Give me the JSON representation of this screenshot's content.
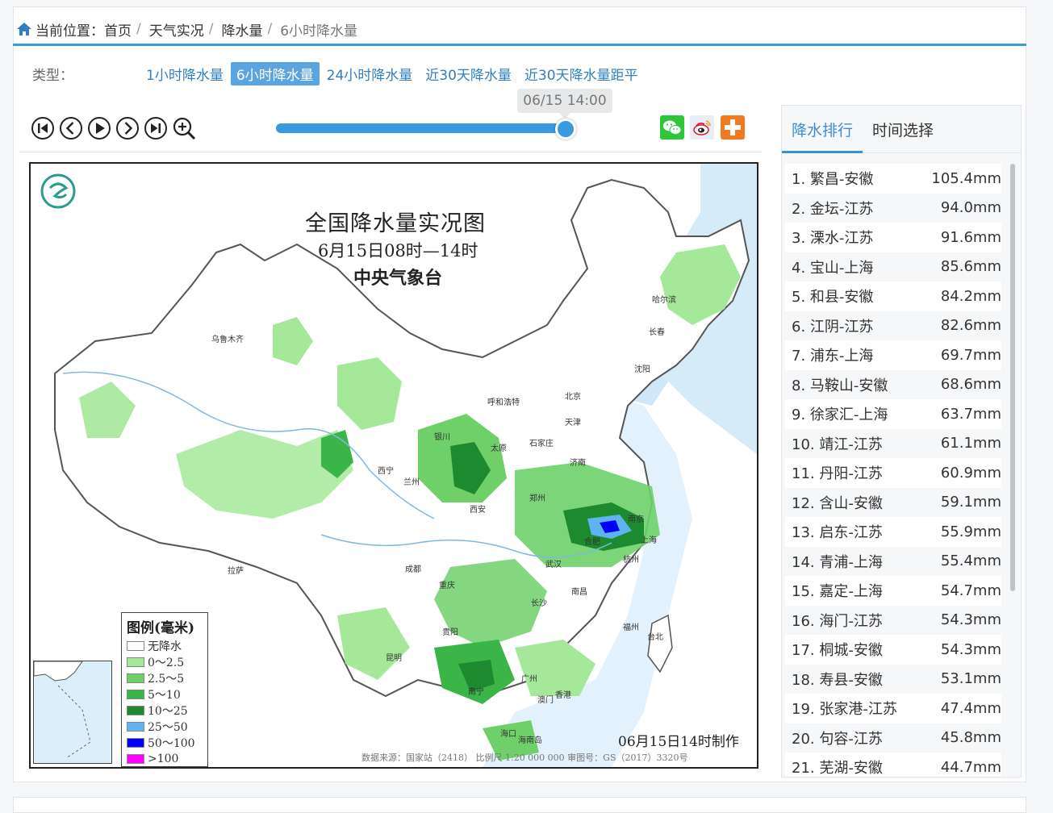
{
  "breadcrumb": {
    "prefix": "当前位置：",
    "items": [
      "首页",
      "天气实况",
      "降水量",
      "6小时降水量"
    ]
  },
  "type_bar": {
    "label": "类型：",
    "options": [
      "1小时降水量",
      "6小时降水量",
      "24小时降水量",
      "近30天降水量",
      "近30天降水量距平"
    ],
    "active_index": 1
  },
  "player": {
    "time_tip": "06/15 14:00",
    "progress": 1.0,
    "controls": [
      "first-icon",
      "prev-icon",
      "play-icon",
      "next-icon",
      "last-icon",
      "zoom-in-icon"
    ],
    "share": [
      "wechat-icon",
      "weibo-icon",
      "plus-icon"
    ]
  },
  "map": {
    "title": "全国降水量实况图",
    "subtitle": "6月15日08时—14时",
    "org": "中央气象台",
    "made": "06月15日14时制作",
    "source": "数据来源：国家站（2418）  比例尺 1:20 000 000    审图号：GS（2017）3320号",
    "legend_title": "图例(毫米)",
    "legend": [
      {
        "label": "无降水",
        "color": "#ffffff"
      },
      {
        "label": "0～2.5",
        "color": "#a6e89a"
      },
      {
        "label": "2.5～5",
        "color": "#6fd06a"
      },
      {
        "label": "5～10",
        "color": "#3cb548"
      },
      {
        "label": "10～25",
        "color": "#1e8a30"
      },
      {
        "label": "25～50",
        "color": "#5fb3f0"
      },
      {
        "label": "50～100",
        "color": "#0000ff"
      },
      {
        "label": ">100",
        "color": "#ff00ff"
      }
    ],
    "cities": [
      "乌鲁木齐",
      "哈尔滨",
      "长春",
      "沈阳",
      "呼和浩特",
      "北京",
      "天津",
      "银川",
      "太原",
      "石家庄",
      "西宁",
      "兰州",
      "济南",
      "郑州",
      "西安",
      "合肥",
      "南京",
      "上海",
      "杭州",
      "成都",
      "武汉",
      "重庆",
      "南昌",
      "拉萨",
      "长沙",
      "福州",
      "贵阳",
      "台北",
      "昆明",
      "南宁",
      "广州",
      "澳门",
      "香港",
      "海口",
      "海南岛"
    ]
  },
  "sidebar": {
    "tabs": [
      "降水排行",
      "时间选择"
    ],
    "active_tab": 0,
    "ranking": [
      {
        "name": "1. 繁昌-安徽",
        "value": "105.4mm"
      },
      {
        "name": "2. 金坛-江苏",
        "value": "94.0mm"
      },
      {
        "name": "3. 溧水-江苏",
        "value": "91.6mm"
      },
      {
        "name": "4. 宝山-上海",
        "value": "85.6mm"
      },
      {
        "name": "5. 和县-安徽",
        "value": "84.2mm"
      },
      {
        "name": "6. 江阴-江苏",
        "value": "82.6mm"
      },
      {
        "name": "7. 浦东-上海",
        "value": "69.7mm"
      },
      {
        "name": "8. 马鞍山-安徽",
        "value": "68.6mm"
      },
      {
        "name": "9. 徐家汇-上海",
        "value": "63.7mm"
      },
      {
        "name": "10. 靖江-江苏",
        "value": "61.1mm"
      },
      {
        "name": "11. 丹阳-江苏",
        "value": "60.9mm"
      },
      {
        "name": "12. 含山-安徽",
        "value": "59.1mm"
      },
      {
        "name": "13. 启东-江苏",
        "value": "55.9mm"
      },
      {
        "name": "14. 青浦-上海",
        "value": "55.4mm"
      },
      {
        "name": "15. 嘉定-上海",
        "value": "54.7mm"
      },
      {
        "name": "16. 海门-江苏",
        "value": "54.3mm"
      },
      {
        "name": "17. 桐城-安徽",
        "value": "54.3mm"
      },
      {
        "name": "18. 寿县-安徽",
        "value": "53.1mm"
      },
      {
        "name": "19. 张家港-江苏",
        "value": "47.4mm"
      },
      {
        "name": "20. 句容-江苏",
        "value": "45.8mm"
      },
      {
        "name": "21. 芜湖-安徽",
        "value": "44.7mm"
      }
    ]
  }
}
